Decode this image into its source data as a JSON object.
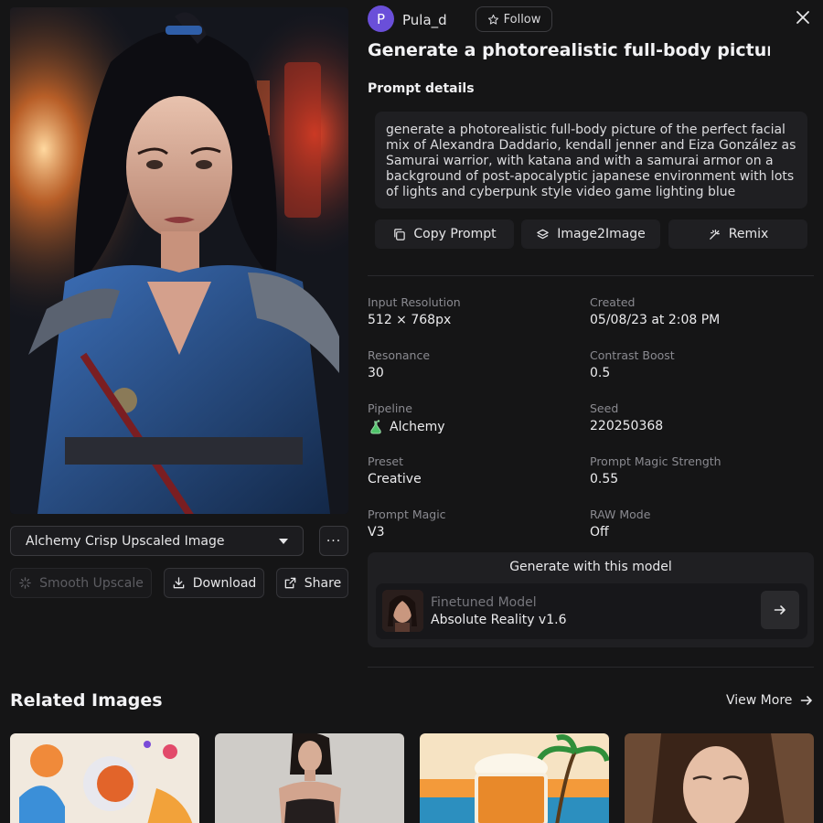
{
  "header": {
    "avatar_letter": "P",
    "username": "Pula_d",
    "follow_label": "Follow",
    "title": "Generate a photorealistic full-body picture of ..."
  },
  "prompt": {
    "section_label": "Prompt details",
    "text": "generate a photorealistic full-body picture of the perfect facial mix of Alexandra Daddario, kendall jenner and Eiza González as Samurai warrior, with katana and with a samurai armor on a background of post-apocalyptic japanese environment with lots of lights and cyberpunk style video game lighting blue",
    "actions": [
      {
        "label": "Copy Prompt",
        "icon": "copy-icon"
      },
      {
        "label": "Image2Image",
        "icon": "layers-icon"
      },
      {
        "label": "Remix",
        "icon": "magic-wand-icon"
      }
    ]
  },
  "image_controls": {
    "variant_select": "Alchemy Crisp Upscaled Image",
    "more_label": "···",
    "smooth_upscale_label": "Smooth Upscale",
    "download_label": "Download",
    "share_label": "Share"
  },
  "details": [
    {
      "label": "Input Resolution",
      "value": "512 × 768px"
    },
    {
      "label": "Created",
      "value": "05/08/23 at 2:08 PM"
    },
    {
      "label": "Resonance",
      "value": "30"
    },
    {
      "label": "Contrast Boost",
      "value": "0.5"
    },
    {
      "label": "Pipeline",
      "value": "Alchemy",
      "icon": "potion-icon"
    },
    {
      "label": "Seed",
      "value": "220250368"
    },
    {
      "label": "Preset",
      "value": "Creative"
    },
    {
      "label": "Prompt Magic Strength",
      "value": "0.55"
    },
    {
      "label": "Prompt Magic",
      "value": "V3"
    },
    {
      "label": "RAW Mode",
      "value": "Off"
    }
  ],
  "generate": {
    "title": "Generate with this model",
    "model_sub": "Finetuned Model",
    "model_name": "Absolute Reality v1.6"
  },
  "related": {
    "title": "Related Images",
    "view_more": "View More"
  },
  "colors": {
    "background": "#151516",
    "card": "#1f1f22",
    "accent_avatar": "#6a4fd9",
    "potion_green": "#4fc46a"
  }
}
